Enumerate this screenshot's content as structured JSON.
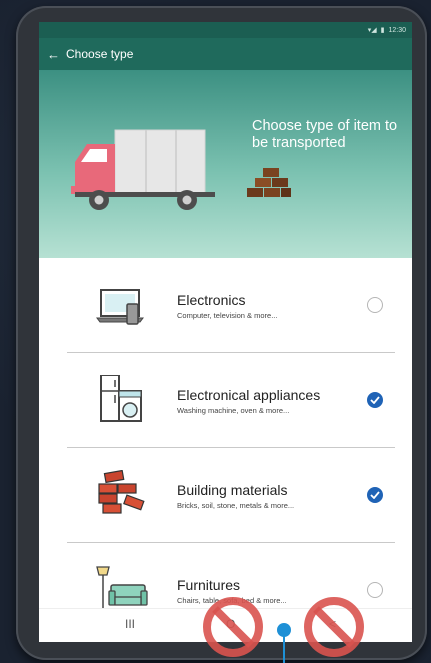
{
  "statusbar": {
    "time": "12:30"
  },
  "appbar": {
    "back_glyph": "←",
    "title": "Choose type"
  },
  "hero": {
    "text": "Choose type of item to be transported"
  },
  "items": [
    {
      "name": "Electronics",
      "desc": "Computer, television & more...",
      "checked": false,
      "icon": "laptop-phone-icon"
    },
    {
      "name": "Electronical appliances",
      "desc": "Washing machine, oven & more...",
      "checked": true,
      "icon": "fridge-washer-icon"
    },
    {
      "name": "Building materials",
      "desc": "Bricks, soil, stone, metals & more...",
      "checked": true,
      "icon": "bricks-icon"
    },
    {
      "name": "Furnitures",
      "desc": "Chairs, table, sofa, bed & more...",
      "checked": false,
      "icon": "sofa-lamp-icon"
    }
  ],
  "navbar": {
    "recents_glyph": "III",
    "home_glyph": "O",
    "back_glyph": "<"
  },
  "colors": {
    "appbar": "#1f6a5c",
    "hero_top": "#3c9082",
    "hero_bottom": "#b6e1d3",
    "check_blue": "#1f63b6",
    "truck_cab": "#e8697a",
    "no_sign_red": "#d9534f",
    "pointer_blue": "#1e90d6"
  }
}
